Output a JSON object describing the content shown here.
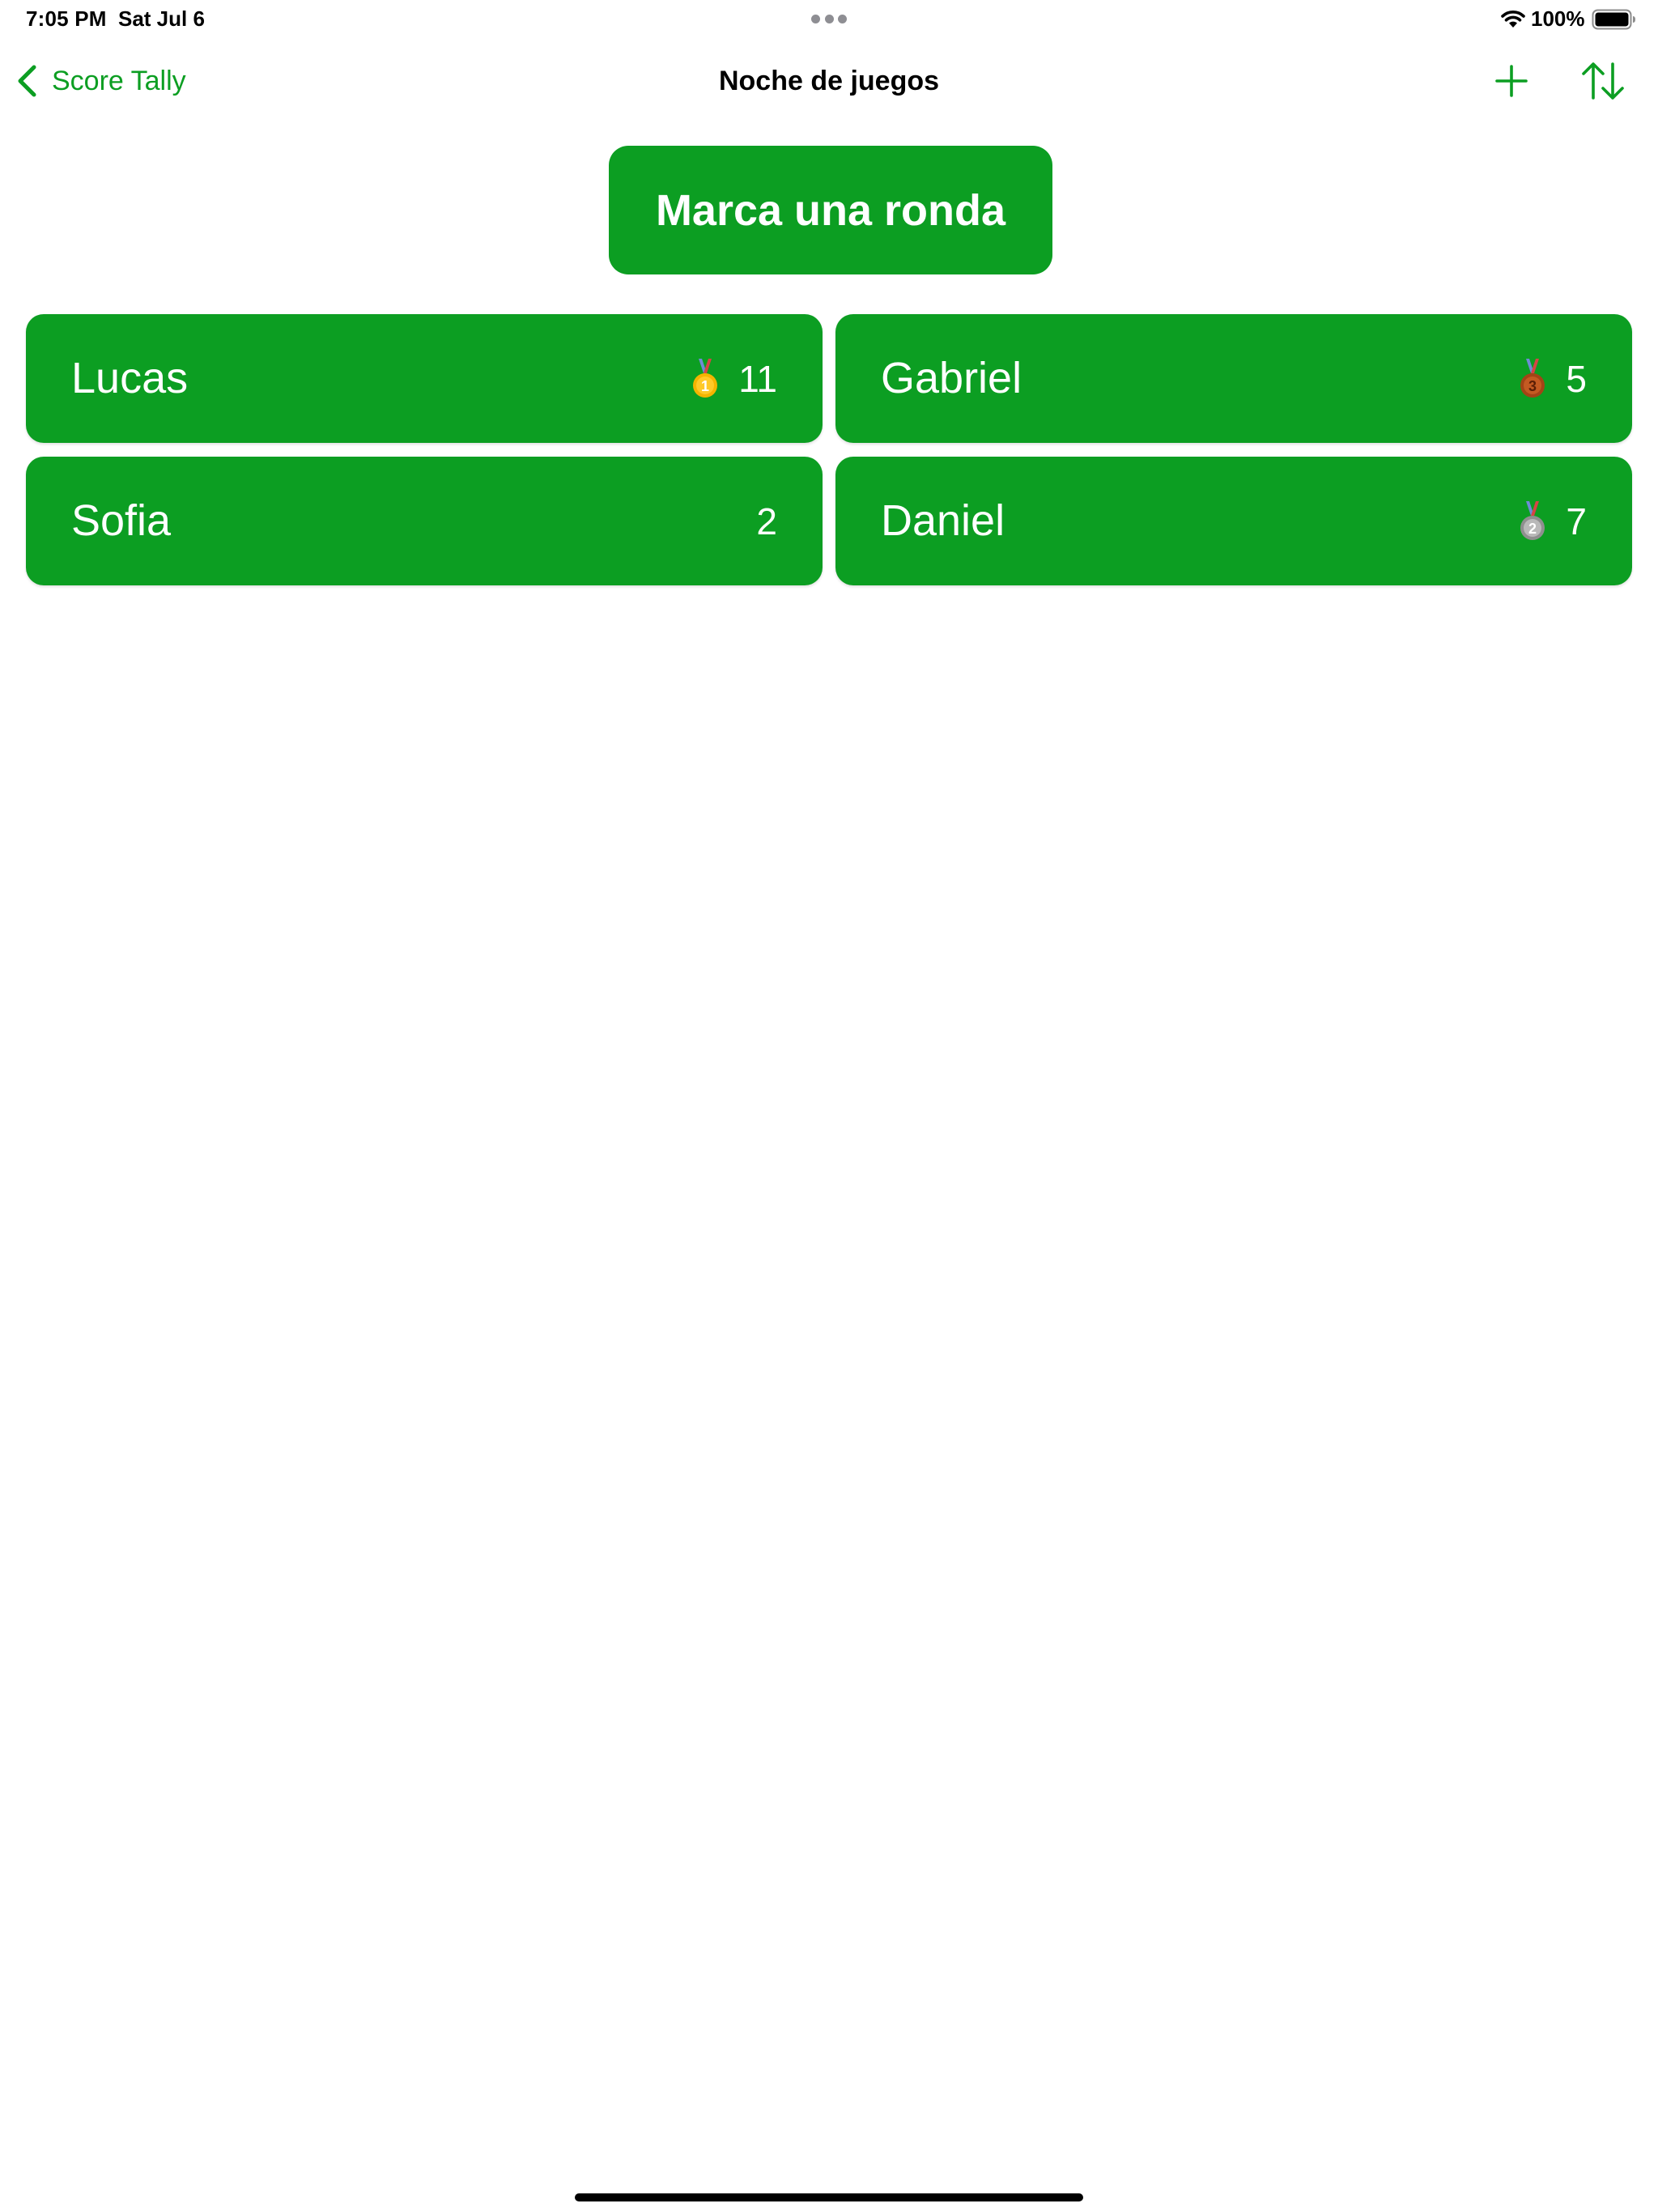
{
  "status_bar": {
    "time": "7:05 PM",
    "date": "Sat Jul 6",
    "battery": "100%"
  },
  "nav": {
    "back_label": "Score Tally",
    "title": "Noche de juegos",
    "add_icon": "plus-icon",
    "sort_icon": "sort-arrows-icon"
  },
  "action": {
    "round_label": "Marca una ronda"
  },
  "players": [
    {
      "name": "Lucas",
      "score": "11",
      "medal": "gold-medal-icon",
      "rank": "1"
    },
    {
      "name": "Gabriel",
      "score": "5",
      "medal": "bronze-medal-icon",
      "rank": "3"
    },
    {
      "name": "Sofia",
      "score": "2",
      "medal": "",
      "rank": ""
    },
    {
      "name": "Daniel",
      "score": "7",
      "medal": "silver-medal-icon",
      "rank": "2"
    }
  ],
  "colors": {
    "accent": "#0c9e22",
    "card_text": "#ffffff",
    "gold": "#f4b400",
    "silver": "#a8a8a8",
    "bronze": "#b5501b"
  }
}
